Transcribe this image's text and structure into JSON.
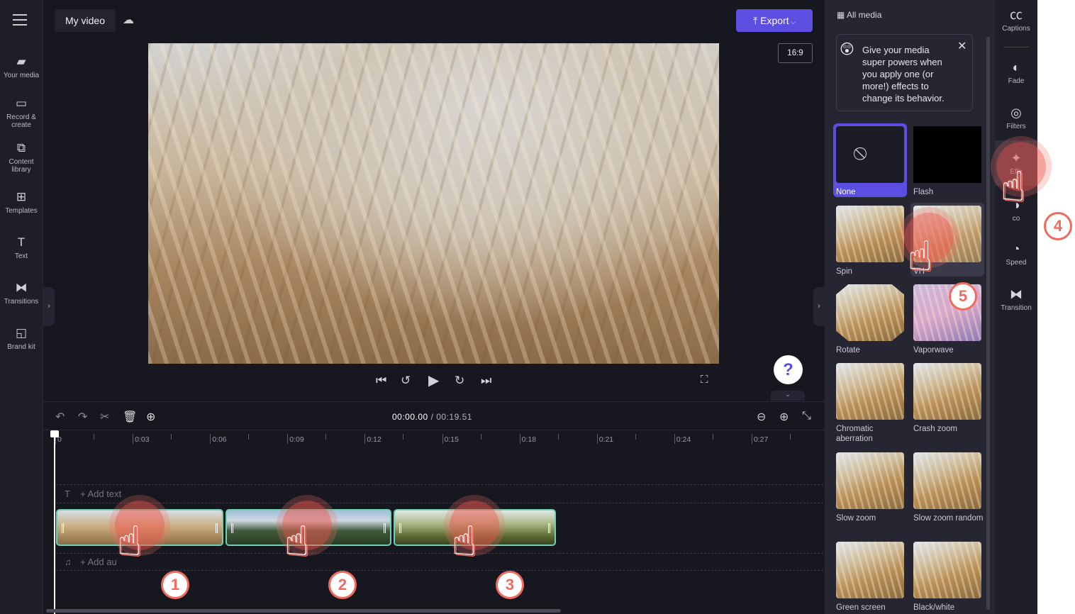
{
  "left_nav": {
    "items": [
      {
        "label": "Your media",
        "icon": "folder-icon"
      },
      {
        "label": "Record & create",
        "icon": "camera-icon"
      },
      {
        "label": "Content library",
        "icon": "library-icon"
      },
      {
        "label": "Templates",
        "icon": "templates-icon"
      },
      {
        "label": "Text",
        "icon": "text-icon"
      },
      {
        "label": "Transitions",
        "icon": "transitions-icon"
      },
      {
        "label": "Brand kit",
        "icon": "brand-kit-icon"
      }
    ]
  },
  "header": {
    "title": "My video",
    "export_label": "Export",
    "aspect_ratio": "16:9"
  },
  "timeline": {
    "current_time": "00:00.00",
    "total_time": "/ 00:19.51",
    "ruler": [
      "0",
      "0:03",
      "0:06",
      "0:09",
      "0:12",
      "0:15",
      "0:18",
      "0:21",
      "0:24",
      "0:27"
    ],
    "add_text": "+ Add text",
    "add_audio": "+ Add au"
  },
  "panel": {
    "header": "All media",
    "tip": "Give your media super powers when you apply one (or more!) effects to change its behavior.",
    "effects": [
      {
        "label": "None",
        "selected": true
      },
      {
        "label": "Flash"
      },
      {
        "label": "Spin"
      },
      {
        "label": "VH"
      },
      {
        "label": "Rotate"
      },
      {
        "label": "Vaporwave"
      },
      {
        "label": "Chromatic aberration"
      },
      {
        "label": "Crash zoom"
      },
      {
        "label": "Slow zoom"
      },
      {
        "label": "Slow zoom random"
      },
      {
        "label": "Green screen"
      },
      {
        "label": "Black/white"
      }
    ]
  },
  "right_strip": {
    "items": [
      {
        "label": "Captions",
        "icon": "captions-icon"
      },
      {
        "label": "Fade",
        "icon": "fade-icon"
      },
      {
        "label": "Filters",
        "icon": "filters-icon"
      },
      {
        "label": "Effe",
        "icon": "effects-icon",
        "active": true
      },
      {
        "label": "co",
        "icon": "adjust-colors-icon"
      },
      {
        "label": "Speed",
        "icon": "speed-icon"
      },
      {
        "label": "Transition",
        "icon": "transition-icon"
      }
    ]
  },
  "annotations": [
    "1",
    "2",
    "3",
    "4",
    "5"
  ],
  "colors": {
    "accent": "#5b4ee0",
    "clip_border": "#6fd1b0",
    "tap": "#f06a5e"
  }
}
